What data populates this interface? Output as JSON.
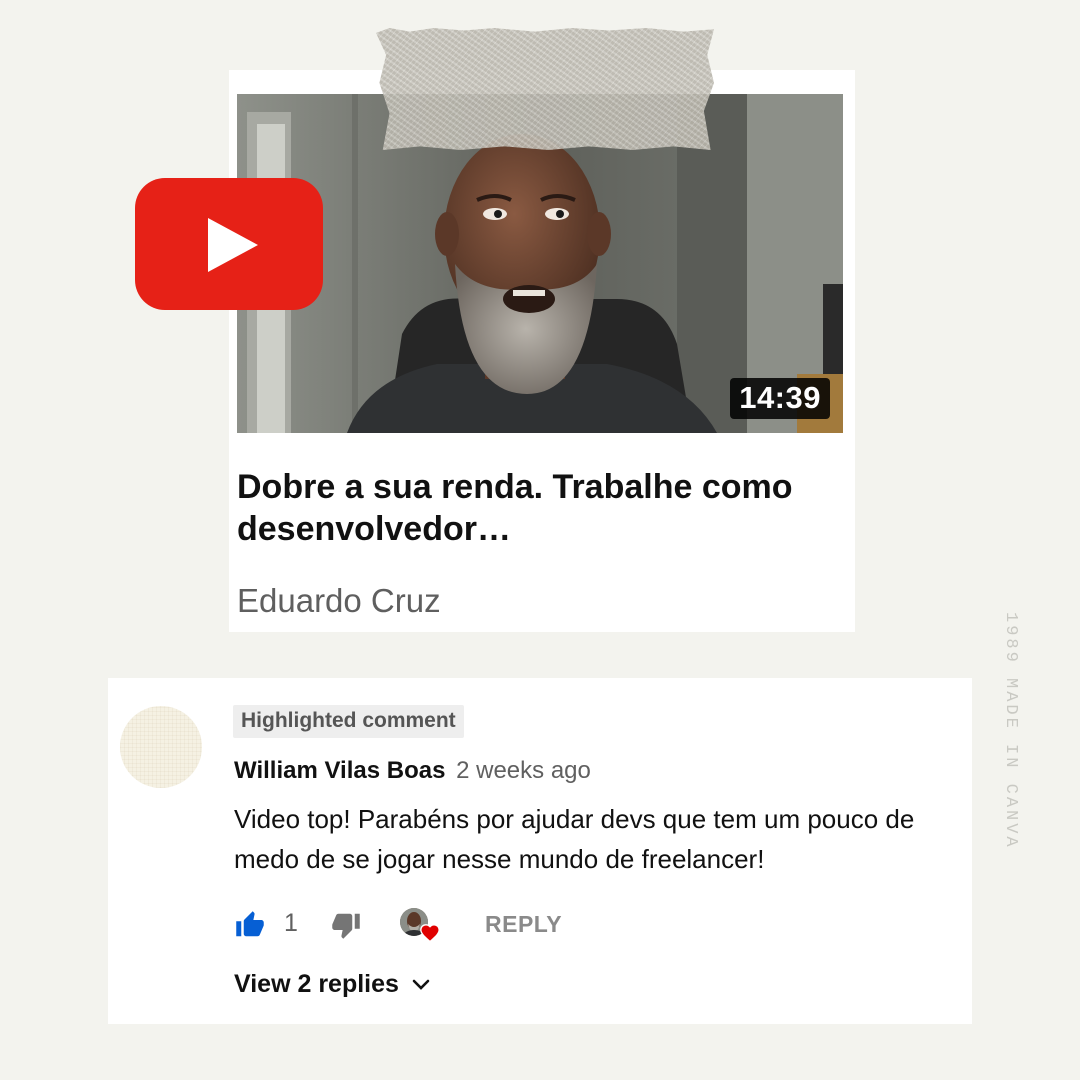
{
  "video": {
    "duration": "14:39",
    "title": "Dobre a sua renda. Trabalhe como desenvolvedor…",
    "channel": "Eduardo Cruz"
  },
  "watermark": {
    "text": "1989 MADE IN CANVA"
  },
  "comment": {
    "badge": "Highlighted comment",
    "author": "William Vilas Boas",
    "time": "2 weeks ago",
    "text": "Video top! Parabéns por ajudar devs que tem um pouco de medo de se jogar nesse mundo de freelancer!",
    "like_count": "1",
    "reply_label": "REPLY",
    "view_replies_label": "View 2 replies"
  },
  "icons": {
    "logo": "youtube-logo",
    "like": "thumbs-up-icon",
    "dislike": "thumbs-down-icon",
    "heart": "heart-icon",
    "chevron": "chevron-down-icon"
  },
  "colors": {
    "youtube_red": "#e62117",
    "like_blue": "#065fd4",
    "heart_red": "#e00000"
  }
}
